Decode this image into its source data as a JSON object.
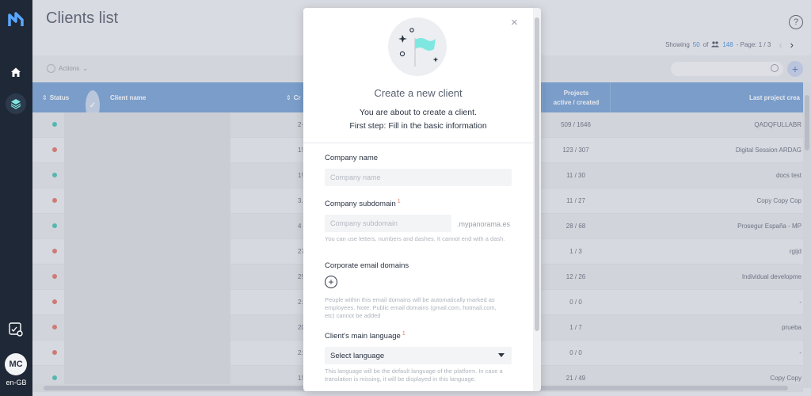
{
  "nav": {
    "locale": "en-GB",
    "avatar_initials": "MC",
    "icons": [
      "app-logo-icon",
      "home-icon",
      "layers-icon",
      "settings-icon"
    ]
  },
  "page": {
    "title": "Clients list",
    "help": "?",
    "actions_label": "Actions",
    "pager": {
      "showing_label": "Showing",
      "showing_count": "50",
      "of_label": "of",
      "total": "148",
      "page_label": "- Page: 1 / 3"
    }
  },
  "table": {
    "headers": {
      "status": "Status",
      "client_name": "Client name",
      "created": "Cr",
      "projects_line1": "Projects",
      "projects_line2": "active / created",
      "last_project": "Last project crea"
    },
    "rows": [
      {
        "status": "#4fc3b8",
        "created": "2·",
        "projects": "509 / 1646",
        "last": "QADQFULLABR"
      },
      {
        "status": "#e07a6f",
        "created": "1!",
        "projects": "123 / 307",
        "last": "Digital Session ARDAG"
      },
      {
        "status": "#4fc3b8",
        "created": "1!",
        "projects": "11 / 30",
        "last": "docs test"
      },
      {
        "status": "#e07a6f",
        "created": "3.",
        "projects": "11 / 27",
        "last": "Copy Copy Cop"
      },
      {
        "status": "#4fc3b8",
        "created": "4",
        "projects": "28 / 68",
        "last": "Prosegur España - MP"
      },
      {
        "status": "#e07a6f",
        "created": "27",
        "projects": "1 / 3",
        "last": "rgijd"
      },
      {
        "status": "#e07a6f",
        "created": "2!",
        "projects": "12 / 26",
        "last": "Individual developme"
      },
      {
        "status": "#e07a6f",
        "created": "2:",
        "projects": "0 / 0",
        "last": "-"
      },
      {
        "status": "#e07a6f",
        "created": "20",
        "projects": "1 / 7",
        "last": "prueba"
      },
      {
        "status": "#e07a6f",
        "created": "2:",
        "projects": "0 / 0",
        "last": "-"
      },
      {
        "status": "#4fc3b8",
        "created": "1!",
        "projects": "21 / 49",
        "last": "Copy Copy"
      }
    ]
  },
  "modal": {
    "close": "×",
    "title": "Create a new client",
    "subtitle_line1": "You are about to create a client.",
    "subtitle_line2": "First step: Fill in the basic information",
    "company_name_label": "Company name",
    "company_name_placeholder": "Company name",
    "subdomain_label": "Company subdomain",
    "subdomain_req": "1",
    "subdomain_placeholder": "Company subdomain",
    "subdomain_suffix": ".mypanorama.es",
    "subdomain_hint": "You can use letters, numbers and dashes. It cannot end with a dash.",
    "email_domains_label": "Corporate email domains",
    "email_domains_add": "+",
    "email_domains_hint": "People within this email domains will be automatically marked as employees. Note: Public email domains (gmail.com, hotmail.com, etc) cannot be added",
    "language_label": "Client's main language",
    "language_req": "1",
    "language_value": "Select language",
    "language_hint": "This language will be the default language of the platform. In case a translation is missing, it will be displayed in this language."
  },
  "colors": {
    "nav_bg": "#1f2836",
    "table_header": "#7aa4d6",
    "accent": "#4a90d9",
    "flag": "#7ee8e0"
  }
}
